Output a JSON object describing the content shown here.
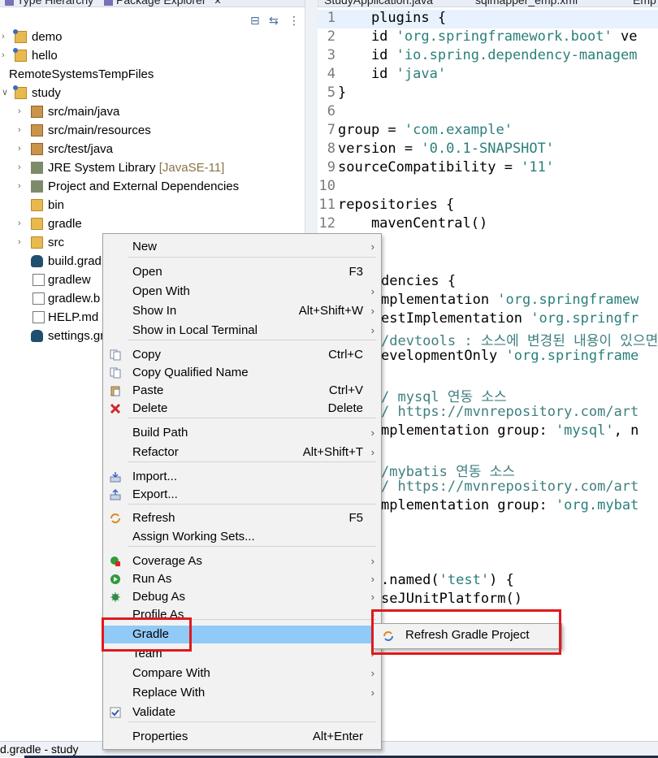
{
  "tabs_left": [
    {
      "label": "Type Hierarchy"
    },
    {
      "label": "Package Explorer",
      "close": "✕"
    }
  ],
  "tabs_right": [
    {
      "label": "StudyApplication.java"
    },
    {
      "label": "sqlmapper_emp.xml"
    },
    {
      "label": "Emp"
    }
  ],
  "explorer": {
    "toolbar": {
      "collapse": "⊟",
      "link": "⇆",
      "menu": "⋮"
    },
    "items": [
      {
        "label": "demo",
        "extra": ""
      },
      {
        "label": "hello",
        "extra": ""
      },
      {
        "label": "RemoteSystemsTempFiles",
        "extra": ""
      },
      {
        "label": "study",
        "extra": ""
      },
      {
        "label": "src/main/java",
        "extra": ""
      },
      {
        "label": "src/main/resources",
        "extra": ""
      },
      {
        "label": "src/test/java",
        "extra": ""
      },
      {
        "label": "JRE System Library",
        "extra": "[JavaSE-11]"
      },
      {
        "label": "Project and External Dependencies",
        "extra": ""
      },
      {
        "label": "bin",
        "extra": ""
      },
      {
        "label": "gradle",
        "extra": ""
      },
      {
        "label": "src",
        "extra": ""
      },
      {
        "label": "build.grad",
        "extra": ""
      },
      {
        "label": "gradlew",
        "extra": ""
      },
      {
        "label": "gradlew.b",
        "extra": ""
      },
      {
        "label": "HELP.md",
        "extra": ""
      },
      {
        "label": "settings.gr",
        "extra": ""
      }
    ]
  },
  "editor": {
    "line_numbers": [
      "1",
      "2",
      "3",
      "4",
      "5",
      "6",
      "7",
      "8",
      "9",
      "10",
      "11",
      "12"
    ],
    "lines": [
      [
        {
          "t": "    plugins {",
          "c": "kw"
        }
      ],
      [
        {
          "t": "    id ",
          "c": "kw"
        },
        {
          "t": "'org.springframework.boot'",
          "c": "str"
        },
        {
          "t": " ve",
          "c": "kw"
        }
      ],
      [
        {
          "t": "    id ",
          "c": "kw"
        },
        {
          "t": "'io.spring.dependency-managem",
          "c": "str"
        }
      ],
      [
        {
          "t": "    id ",
          "c": "kw"
        },
        {
          "t": "'java'",
          "c": "str"
        }
      ],
      [
        {
          "t": "}",
          "c": "kw"
        }
      ],
      [
        {
          "t": "",
          "c": "kw"
        }
      ],
      [
        {
          "t": "group = ",
          "c": "kw"
        },
        {
          "t": "'com.example'",
          "c": "str"
        }
      ],
      [
        {
          "t": "version = ",
          "c": "kw"
        },
        {
          "t": "'0.0.1-SNAPSHOT'",
          "c": "str"
        }
      ],
      [
        {
          "t": "sourceCompatibility = ",
          "c": "kw"
        },
        {
          "t": "'11'",
          "c": "str"
        }
      ],
      [
        {
          "t": "",
          "c": "kw"
        }
      ],
      [
        {
          "t": "repositories {",
          "c": "kw"
        }
      ],
      [
        {
          "t": "    mavenCentral()",
          "c": "kw"
        }
      ]
    ],
    "visible_fragments": [
      [
        {
          "t": "dencies {",
          "c": "kw"
        }
      ],
      [
        {
          "t": "mplementation ",
          "c": "kw"
        },
        {
          "t": "'org.springframew",
          "c": "str"
        }
      ],
      [
        {
          "t": "estImplementation ",
          "c": "kw"
        },
        {
          "t": "'org.springfr",
          "c": "str"
        }
      ],
      [
        {
          "t": "/devtools : 소스에 변경된 내용이 있으면",
          "c": "cm"
        }
      ],
      [
        {
          "t": "evelopmentOnly ",
          "c": "kw"
        },
        {
          "t": "'org.springframe",
          "c": "str"
        }
      ],
      [
        {
          "t": "",
          "c": "kw"
        }
      ],
      [
        {
          "t": "/ mysql 연동 소스",
          "c": "cm"
        }
      ],
      [
        {
          "t": "/ https://mvnrepository.com/art",
          "c": "cm"
        }
      ],
      [
        {
          "t": "mplementation group: ",
          "c": "kw"
        },
        {
          "t": "'mysql'",
          "c": "str"
        },
        {
          "t": ", n",
          "c": "kw"
        }
      ],
      [
        {
          "t": "",
          "c": "kw"
        }
      ],
      [
        {
          "t": "/mybatis 연동 소스",
          "c": "cm"
        }
      ],
      [
        {
          "t": "/ https://mvnrepository.com/art",
          "c": "cm"
        }
      ],
      [
        {
          "t": "mplementation group: ",
          "c": "kw"
        },
        {
          "t": "'org.mybat",
          "c": "str"
        }
      ],
      [
        {
          "t": "",
          "c": "kw"
        }
      ],
      [
        {
          "t": "",
          "c": "kw"
        }
      ],
      [
        {
          "t": "",
          "c": "kw"
        }
      ],
      [
        {
          "t": ".named(",
          "c": "kw"
        },
        {
          "t": "'test'",
          "c": "str"
        },
        {
          "t": ") {",
          "c": "kw"
        }
      ],
      [
        {
          "t": "seJUnitPlatform()",
          "c": "kw"
        }
      ]
    ]
  },
  "context_menu": {
    "items": [
      {
        "label": "New",
        "shortcut": "",
        "submenu": true
      },
      {
        "label": "Open",
        "shortcut": "F3",
        "submenu": false
      },
      {
        "label": "Open With",
        "shortcut": "",
        "submenu": true
      },
      {
        "label": "Show In",
        "shortcut": "Alt+Shift+W",
        "submenu": true
      },
      {
        "label": "Show in Local Terminal",
        "shortcut": "",
        "submenu": true
      },
      {
        "label": "Copy",
        "shortcut": "Ctrl+C",
        "submenu": false,
        "icon": "copy-icon"
      },
      {
        "label": "Copy Qualified Name",
        "shortcut": "",
        "submenu": false,
        "icon": "copy-icon"
      },
      {
        "label": "Paste",
        "shortcut": "Ctrl+V",
        "submenu": false,
        "icon": "paste-icon"
      },
      {
        "label": "Delete",
        "shortcut": "Delete",
        "submenu": false,
        "icon": "delete-icon"
      },
      {
        "label": "Build Path",
        "shortcut": "",
        "submenu": true
      },
      {
        "label": "Refactor",
        "shortcut": "Alt+Shift+T",
        "submenu": true
      },
      {
        "label": "Import...",
        "shortcut": "",
        "submenu": false,
        "icon": "import-icon"
      },
      {
        "label": "Export...",
        "shortcut": "",
        "submenu": false,
        "icon": "export-icon"
      },
      {
        "label": "Refresh",
        "shortcut": "F5",
        "submenu": false,
        "icon": "refresh-icon"
      },
      {
        "label": "Assign Working Sets...",
        "shortcut": "",
        "submenu": false
      },
      {
        "label": "Coverage As",
        "shortcut": "",
        "submenu": true,
        "icon": "coverage-icon"
      },
      {
        "label": "Run As",
        "shortcut": "",
        "submenu": true,
        "icon": "run-icon"
      },
      {
        "label": "Debug As",
        "shortcut": "",
        "submenu": true,
        "icon": "debug-icon"
      },
      {
        "label": "Profile As",
        "shortcut": "",
        "submenu": true
      },
      {
        "label": "Gradle",
        "shortcut": "",
        "submenu": true
      },
      {
        "label": "Team",
        "shortcut": "",
        "submenu": true
      },
      {
        "label": "Compare With",
        "shortcut": "",
        "submenu": true
      },
      {
        "label": "Replace With",
        "shortcut": "",
        "submenu": true
      },
      {
        "label": "Validate",
        "shortcut": "",
        "submenu": false,
        "icon": "check-icon"
      },
      {
        "label": "Properties",
        "shortcut": "Alt+Enter",
        "submenu": false
      }
    ],
    "active_item": "Gradle",
    "submenu_arrow": "›"
  },
  "gradle_submenu": {
    "items": [
      {
        "label": "Refresh Gradle Project"
      }
    ]
  },
  "status_bar": {
    "text": "d.gradle - study"
  },
  "colors": {
    "highlight": "#91c9f7",
    "annotation_red": "#e0191c",
    "string": "#2a7f7a"
  }
}
